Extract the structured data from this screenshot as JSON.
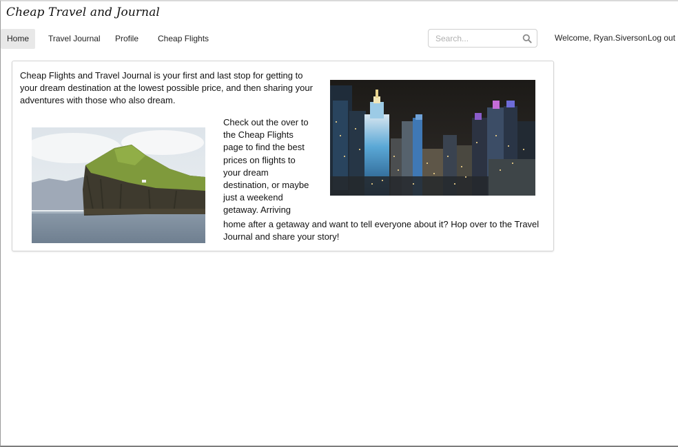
{
  "brand": {
    "title": "Cheap Travel and Journal"
  },
  "nav": {
    "items": [
      {
        "label": "Home",
        "active": true
      },
      {
        "label": "Travel Journal",
        "active": false
      },
      {
        "label": "Profile",
        "active": false
      },
      {
        "label": "Cheap Flights",
        "active": false
      }
    ],
    "search": {
      "placeholder": "Search...",
      "value": "",
      "icon": "search-icon"
    },
    "welcome": "Welcome, Ryan.Siverson",
    "logout": "Log out"
  },
  "content": {
    "intro": "Cheap Flights and Travel Journal is your first and last stop for getting to your dream destination at the lowest possible price, and then sharing your adventures with those who also dream.",
    "para2_lines": [
      "Check out the over to",
      "the Cheap Flights",
      "page to find the best",
      "prices on flights to",
      "your dream",
      "destination, or maybe",
      "just a weekend",
      "getaway. Arriving"
    ],
    "para2_tail": "home after a getaway and want to tell everyone about it? Hop over to the Travel Journal and share your story!",
    "images": [
      {
        "name": "city-skyline-night",
        "icon": "city-photo"
      },
      {
        "name": "island-cliff-sea",
        "icon": "island-photo"
      }
    ]
  },
  "colors": {
    "nav_active_bg": "#e8e8e8",
    "panel_border": "#d4d4d4",
    "text": "#111111"
  }
}
